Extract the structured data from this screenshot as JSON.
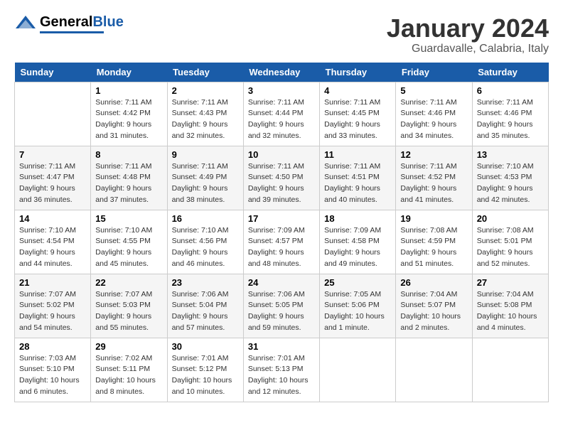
{
  "header": {
    "logo_general": "General",
    "logo_blue": "Blue",
    "month": "January 2024",
    "location": "Guardavalle, Calabria, Italy"
  },
  "days_of_week": [
    "Sunday",
    "Monday",
    "Tuesday",
    "Wednesday",
    "Thursday",
    "Friday",
    "Saturday"
  ],
  "weeks": [
    [
      {
        "num": "",
        "sunrise": "",
        "sunset": "",
        "daylight": ""
      },
      {
        "num": "1",
        "sunrise": "Sunrise: 7:11 AM",
        "sunset": "Sunset: 4:42 PM",
        "daylight": "Daylight: 9 hours and 31 minutes."
      },
      {
        "num": "2",
        "sunrise": "Sunrise: 7:11 AM",
        "sunset": "Sunset: 4:43 PM",
        "daylight": "Daylight: 9 hours and 32 minutes."
      },
      {
        "num": "3",
        "sunrise": "Sunrise: 7:11 AM",
        "sunset": "Sunset: 4:44 PM",
        "daylight": "Daylight: 9 hours and 32 minutes."
      },
      {
        "num": "4",
        "sunrise": "Sunrise: 7:11 AM",
        "sunset": "Sunset: 4:45 PM",
        "daylight": "Daylight: 9 hours and 33 minutes."
      },
      {
        "num": "5",
        "sunrise": "Sunrise: 7:11 AM",
        "sunset": "Sunset: 4:46 PM",
        "daylight": "Daylight: 9 hours and 34 minutes."
      },
      {
        "num": "6",
        "sunrise": "Sunrise: 7:11 AM",
        "sunset": "Sunset: 4:46 PM",
        "daylight": "Daylight: 9 hours and 35 minutes."
      }
    ],
    [
      {
        "num": "7",
        "sunrise": "Sunrise: 7:11 AM",
        "sunset": "Sunset: 4:47 PM",
        "daylight": "Daylight: 9 hours and 36 minutes."
      },
      {
        "num": "8",
        "sunrise": "Sunrise: 7:11 AM",
        "sunset": "Sunset: 4:48 PM",
        "daylight": "Daylight: 9 hours and 37 minutes."
      },
      {
        "num": "9",
        "sunrise": "Sunrise: 7:11 AM",
        "sunset": "Sunset: 4:49 PM",
        "daylight": "Daylight: 9 hours and 38 minutes."
      },
      {
        "num": "10",
        "sunrise": "Sunrise: 7:11 AM",
        "sunset": "Sunset: 4:50 PM",
        "daylight": "Daylight: 9 hours and 39 minutes."
      },
      {
        "num": "11",
        "sunrise": "Sunrise: 7:11 AM",
        "sunset": "Sunset: 4:51 PM",
        "daylight": "Daylight: 9 hours and 40 minutes."
      },
      {
        "num": "12",
        "sunrise": "Sunrise: 7:11 AM",
        "sunset": "Sunset: 4:52 PM",
        "daylight": "Daylight: 9 hours and 41 minutes."
      },
      {
        "num": "13",
        "sunrise": "Sunrise: 7:10 AM",
        "sunset": "Sunset: 4:53 PM",
        "daylight": "Daylight: 9 hours and 42 minutes."
      }
    ],
    [
      {
        "num": "14",
        "sunrise": "Sunrise: 7:10 AM",
        "sunset": "Sunset: 4:54 PM",
        "daylight": "Daylight: 9 hours and 44 minutes."
      },
      {
        "num": "15",
        "sunrise": "Sunrise: 7:10 AM",
        "sunset": "Sunset: 4:55 PM",
        "daylight": "Daylight: 9 hours and 45 minutes."
      },
      {
        "num": "16",
        "sunrise": "Sunrise: 7:10 AM",
        "sunset": "Sunset: 4:56 PM",
        "daylight": "Daylight: 9 hours and 46 minutes."
      },
      {
        "num": "17",
        "sunrise": "Sunrise: 7:09 AM",
        "sunset": "Sunset: 4:57 PM",
        "daylight": "Daylight: 9 hours and 48 minutes."
      },
      {
        "num": "18",
        "sunrise": "Sunrise: 7:09 AM",
        "sunset": "Sunset: 4:58 PM",
        "daylight": "Daylight: 9 hours and 49 minutes."
      },
      {
        "num": "19",
        "sunrise": "Sunrise: 7:08 AM",
        "sunset": "Sunset: 4:59 PM",
        "daylight": "Daylight: 9 hours and 51 minutes."
      },
      {
        "num": "20",
        "sunrise": "Sunrise: 7:08 AM",
        "sunset": "Sunset: 5:01 PM",
        "daylight": "Daylight: 9 hours and 52 minutes."
      }
    ],
    [
      {
        "num": "21",
        "sunrise": "Sunrise: 7:07 AM",
        "sunset": "Sunset: 5:02 PM",
        "daylight": "Daylight: 9 hours and 54 minutes."
      },
      {
        "num": "22",
        "sunrise": "Sunrise: 7:07 AM",
        "sunset": "Sunset: 5:03 PM",
        "daylight": "Daylight: 9 hours and 55 minutes."
      },
      {
        "num": "23",
        "sunrise": "Sunrise: 7:06 AM",
        "sunset": "Sunset: 5:04 PM",
        "daylight": "Daylight: 9 hours and 57 minutes."
      },
      {
        "num": "24",
        "sunrise": "Sunrise: 7:06 AM",
        "sunset": "Sunset: 5:05 PM",
        "daylight": "Daylight: 9 hours and 59 minutes."
      },
      {
        "num": "25",
        "sunrise": "Sunrise: 7:05 AM",
        "sunset": "Sunset: 5:06 PM",
        "daylight": "Daylight: 10 hours and 1 minute."
      },
      {
        "num": "26",
        "sunrise": "Sunrise: 7:04 AM",
        "sunset": "Sunset: 5:07 PM",
        "daylight": "Daylight: 10 hours and 2 minutes."
      },
      {
        "num": "27",
        "sunrise": "Sunrise: 7:04 AM",
        "sunset": "Sunset: 5:08 PM",
        "daylight": "Daylight: 10 hours and 4 minutes."
      }
    ],
    [
      {
        "num": "28",
        "sunrise": "Sunrise: 7:03 AM",
        "sunset": "Sunset: 5:10 PM",
        "daylight": "Daylight: 10 hours and 6 minutes."
      },
      {
        "num": "29",
        "sunrise": "Sunrise: 7:02 AM",
        "sunset": "Sunset: 5:11 PM",
        "daylight": "Daylight: 10 hours and 8 minutes."
      },
      {
        "num": "30",
        "sunrise": "Sunrise: 7:01 AM",
        "sunset": "Sunset: 5:12 PM",
        "daylight": "Daylight: 10 hours and 10 minutes."
      },
      {
        "num": "31",
        "sunrise": "Sunrise: 7:01 AM",
        "sunset": "Sunset: 5:13 PM",
        "daylight": "Daylight: 10 hours and 12 minutes."
      },
      {
        "num": "",
        "sunrise": "",
        "sunset": "",
        "daylight": ""
      },
      {
        "num": "",
        "sunrise": "",
        "sunset": "",
        "daylight": ""
      },
      {
        "num": "",
        "sunrise": "",
        "sunset": "",
        "daylight": ""
      }
    ]
  ]
}
